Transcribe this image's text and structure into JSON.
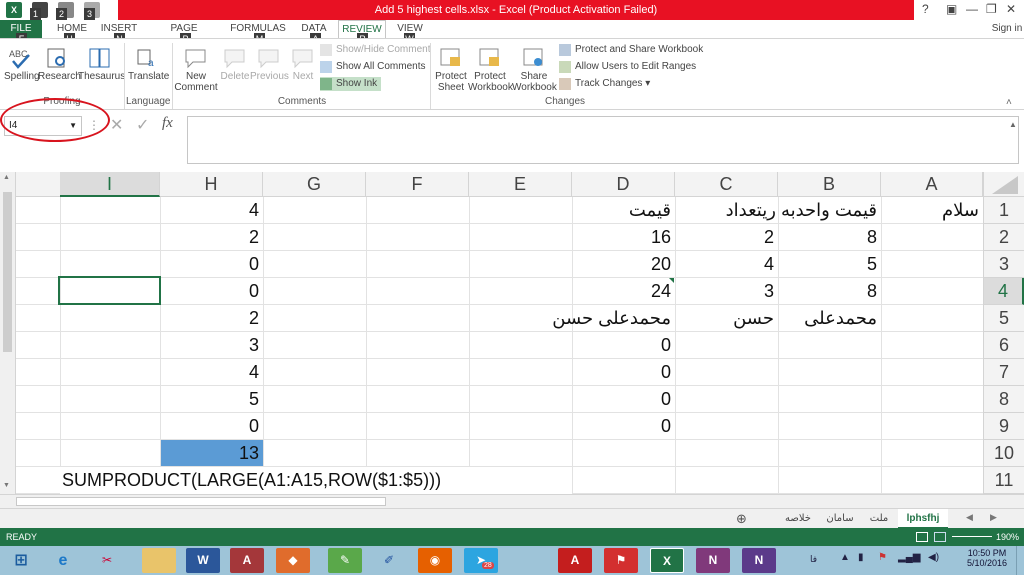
{
  "window": {
    "title": "Add 5 highest cells.xlsx -  Excel (Product Activation Failed)",
    "help": "?",
    "sign_in": "Sign in"
  },
  "tabs": [
    "FILE",
    "HOME",
    "INSERT",
    "PAGE LAYOUT",
    "FORMULAS",
    "DATA",
    "REVIEW",
    "VIEW"
  ],
  "keytips": [
    "F",
    "H",
    "N",
    "P",
    "M",
    "A",
    "R",
    "W"
  ],
  "qat_keytips": [
    "1",
    "2",
    "3"
  ],
  "ribbon": {
    "proofing": {
      "label": "Proofing",
      "spelling": "Spelling",
      "research": "Research",
      "thesaurus": "Thesaurus"
    },
    "language": {
      "label": "Language",
      "translate": "Translate"
    },
    "comments": {
      "label": "Comments",
      "new_comment": "New\nComment",
      "delete": "Delete",
      "previous": "Previous",
      "next": "Next",
      "show_hide": "Show/Hide Comment",
      "show_all": "Show All Comments",
      "show_ink": "Show Ink"
    },
    "changes": {
      "label": "Changes",
      "protect_sheet": "Protect\nSheet",
      "protect_workbook": "Protect\nWorkbook",
      "share_workbook": "Share\nWorkbook",
      "protect_share": "Protect and Share Workbook",
      "allow_users": "Allow Users to Edit Ranges",
      "track_changes": "Track Changes"
    }
  },
  "formula_bar": {
    "name_box": "I4",
    "fx": "fx"
  },
  "columns": [
    "I",
    "H",
    "G",
    "F",
    "E",
    "D",
    "C",
    "B",
    "A"
  ],
  "rows": [
    "1",
    "2",
    "3",
    "4",
    "5",
    "6",
    "7",
    "8",
    "9",
    "10",
    "11"
  ],
  "cells": {
    "H": [
      "4",
      "2",
      "0",
      "0",
      "2",
      "3",
      "4",
      "5",
      "0",
      "13"
    ],
    "D": [
      "قيمت",
      "16",
      "20",
      "24",
      "محمدعلی حسن",
      "0",
      "0",
      "0",
      "0"
    ],
    "C": [
      "",
      "2",
      "4",
      "3",
      "حسن"
    ],
    "B": [
      "قيمت واحد",
      "8",
      "5",
      "8",
      "محمدعلی"
    ],
    "BC_header": "قيمت واحدبه ریتعداد",
    "A": [
      "سلام"
    ],
    "row11": "SUMPRODUCT(LARGE(A1:A15,ROW($1:$5)))"
  },
  "sheets": [
    "خلاصه",
    "سامان",
    "ملت",
    "lphsfhj"
  ],
  "status": {
    "ready": "READY",
    "zoom": "190%"
  },
  "taskbar": {
    "time": "10:50 PM",
    "date": "5/10/2016",
    "lang": "فا",
    "badge": "28"
  },
  "colors": {
    "excel_green": "#217346",
    "title_red": "#e81123",
    "highlight_blue": "#5b9bd5"
  }
}
